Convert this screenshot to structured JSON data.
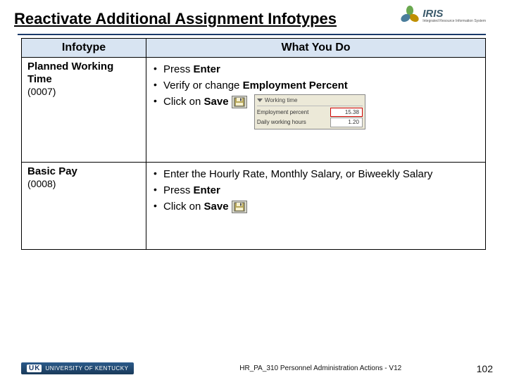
{
  "title": "Reactivate Additional Assignment Infotypes",
  "logo": {
    "text": "IRIS",
    "sub": "Integrated Resource Information System"
  },
  "table": {
    "headers": {
      "col1": "Infotype",
      "col2": "What You Do"
    },
    "rows": [
      {
        "name": "Planned Working Time",
        "code": "(0007)",
        "actions_html": [
          "Press <strong>Enter</strong>",
          "Verify or change <strong>Employment Percent</strong>",
          "Click on <strong>Save</strong>"
        ],
        "mini": {
          "header": "Working time",
          "row1_label": "Employment percent",
          "row1_value": "15.38",
          "row2_label": "Daily working hours",
          "row2_value": "1.20"
        }
      },
      {
        "name": "Basic Pay",
        "code": "(0008)",
        "actions_html": [
          "Enter the Hourly Rate, Monthly Salary, or Biweekly Salary",
          "Press <strong>Enter</strong>",
          "Click on <strong>Save</strong>"
        ]
      }
    ]
  },
  "footer": {
    "uk_abbr": "K",
    "uk_text": "UNIVERSITY OF KENTUCKY",
    "center": "HR_PA_310 Personnel Administration Actions - V12",
    "page": "102"
  }
}
